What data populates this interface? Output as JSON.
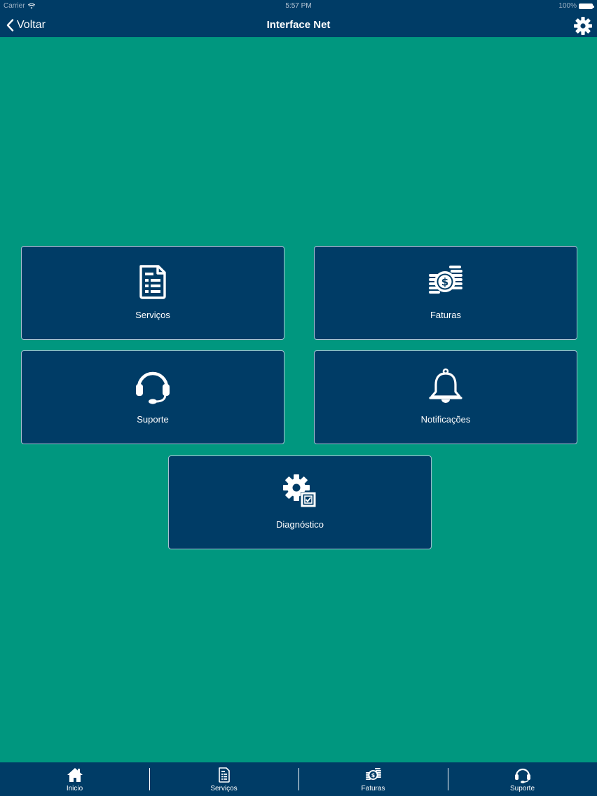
{
  "status_bar": {
    "carrier": "Carrier",
    "time": "5:57 PM",
    "battery": "100%"
  },
  "nav": {
    "back_label": "Voltar",
    "title": "Interface Net"
  },
  "tiles": [
    {
      "label": "Serviços",
      "icon": "document-list-icon"
    },
    {
      "label": "Faturas",
      "icon": "dollar-coins-icon"
    },
    {
      "label": "Suporte",
      "icon": "headset-icon"
    },
    {
      "label": "Notificações",
      "icon": "bell-icon"
    },
    {
      "label": "Diagnóstico",
      "icon": "gear-checklist-icon"
    }
  ],
  "tabbar": [
    {
      "label": "Inicio",
      "icon": "home-icon"
    },
    {
      "label": "Serviços",
      "icon": "document-list-icon"
    },
    {
      "label": "Faturas",
      "icon": "dollar-coins-icon"
    },
    {
      "label": "Suporte",
      "icon": "headset-icon"
    }
  ],
  "colors": {
    "background": "#00977f",
    "bar": "#003c66",
    "tile": "#003c66",
    "tile_border": "#a9c2d3",
    "text": "#ffffff"
  }
}
